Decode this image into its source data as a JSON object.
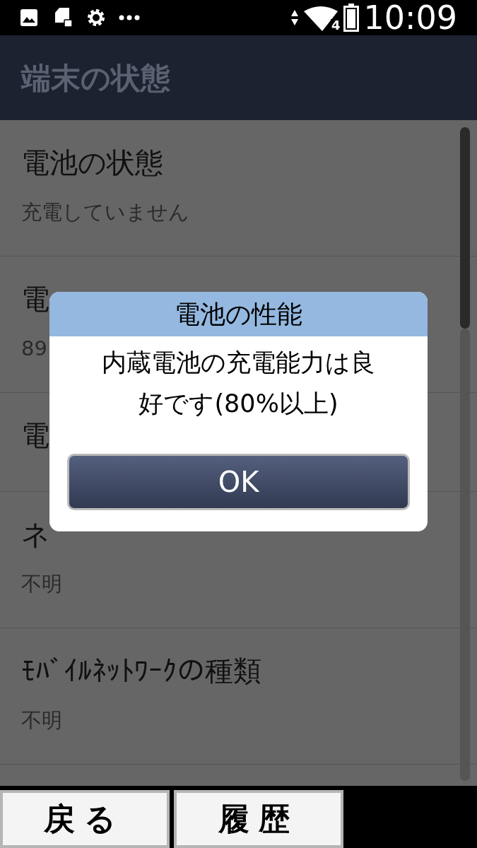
{
  "status_bar": {
    "network_label": "4",
    "time": "10:09"
  },
  "header": {
    "title": "端末の状態"
  },
  "items": [
    {
      "title": "電池の状態",
      "value": "充電していません"
    },
    {
      "title": "電",
      "value": "89"
    },
    {
      "title": "電"
    },
    {
      "title": "ネ",
      "value": "不明"
    },
    {
      "title": "ﾓﾊﾞｲﾙﾈｯﾄﾜｰｸの種類",
      "value": "不明"
    }
  ],
  "dialog": {
    "title": "電池の性能",
    "message": "内蔵電池の充電能力は良好です(80%以上)",
    "button": "OK"
  },
  "bottom_buttons": [
    "戻る",
    "履歴"
  ]
}
